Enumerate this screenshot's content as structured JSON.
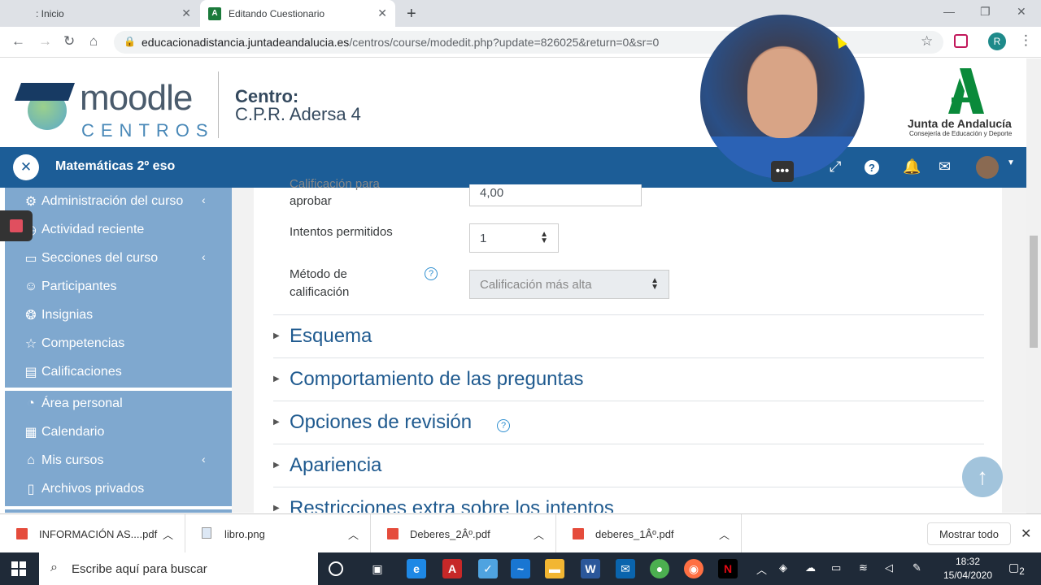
{
  "browser": {
    "tabs": [
      {
        "title": ": Inicio"
      },
      {
        "title": "Editando Cuestionario",
        "favicon": "A"
      }
    ],
    "url_host": "educacionadistancia.juntadeandalucia.es",
    "url_path": "/centros/course/modedit.php?update=826025&return=0&sr=0",
    "profile_initial": "R"
  },
  "header": {
    "logo_word": "moodle",
    "logo_sub": "CENTROS",
    "centro_label": "Centro:",
    "centro_name": "C.P.R. Adersa 4",
    "junta_name": "Junta de Andalucía",
    "junta_sub": "Consejería de Educación y Deporte"
  },
  "topbar": {
    "course_title": "Matemáticas 2º eso"
  },
  "sidebar": {
    "items": [
      {
        "label": "Administración del curso",
        "icon": "gear-icon",
        "chevron": "‹"
      },
      {
        "label": "Actividad reciente",
        "icon": "clock-icon",
        "chevron": ""
      },
      {
        "label": "Secciones del curso",
        "icon": "folder-icon",
        "chevron": "‹"
      },
      {
        "label": "Participantes",
        "icon": "user-icon",
        "chevron": ""
      },
      {
        "label": "Insignias",
        "icon": "badge-icon",
        "chevron": ""
      },
      {
        "label": "Competencias",
        "icon": "star-icon",
        "chevron": ""
      },
      {
        "label": "Calificaciones",
        "icon": "book-icon",
        "chevron": ""
      },
      {
        "label": "Área personal",
        "icon": "dashboard-icon",
        "chevron": ""
      },
      {
        "label": "Calendario",
        "icon": "calendar-icon",
        "chevron": ""
      },
      {
        "label": "Mis cursos",
        "icon": "graduation-icon",
        "chevron": "‹"
      },
      {
        "label": "Archivos privados",
        "icon": "file-icon",
        "chevron": ""
      }
    ]
  },
  "form": {
    "grade_label_line1": "Calificación para",
    "grade_label_line2": "aprobar",
    "grade_value": "4,00",
    "attempts_label": "Intentos permitidos",
    "attempts_value": "1",
    "method_label_line1": "Método de",
    "method_label_line2": "calificación",
    "method_value": "Calificación más alta",
    "help_glyph": "?"
  },
  "sections": [
    {
      "title": "Esquema"
    },
    {
      "title": "Comportamiento de las preguntas"
    },
    {
      "title": "Opciones de revisión"
    },
    {
      "title": "Apariencia"
    },
    {
      "title": "Restricciones extra sobre los intentos"
    }
  ],
  "downloads": {
    "items": [
      {
        "name": "INFORMACIÓN AS....pdf",
        "type": "pdf"
      },
      {
        "name": "libro.png",
        "type": "image"
      },
      {
        "name": "Deberes_2Âº.pdf",
        "type": "pdf"
      },
      {
        "name": "deberes_1Âº.pdf",
        "type": "pdf"
      }
    ],
    "show_all": "Mostrar todo"
  },
  "taskbar": {
    "search_placeholder": "Escribe aquí para buscar",
    "time": "18:32",
    "date": "15/04/2020",
    "notifications": "2"
  },
  "colors": {
    "topbar": "#1c5d97",
    "sidebar": "#7fa8cf",
    "section_title": "#1f5a8f"
  }
}
